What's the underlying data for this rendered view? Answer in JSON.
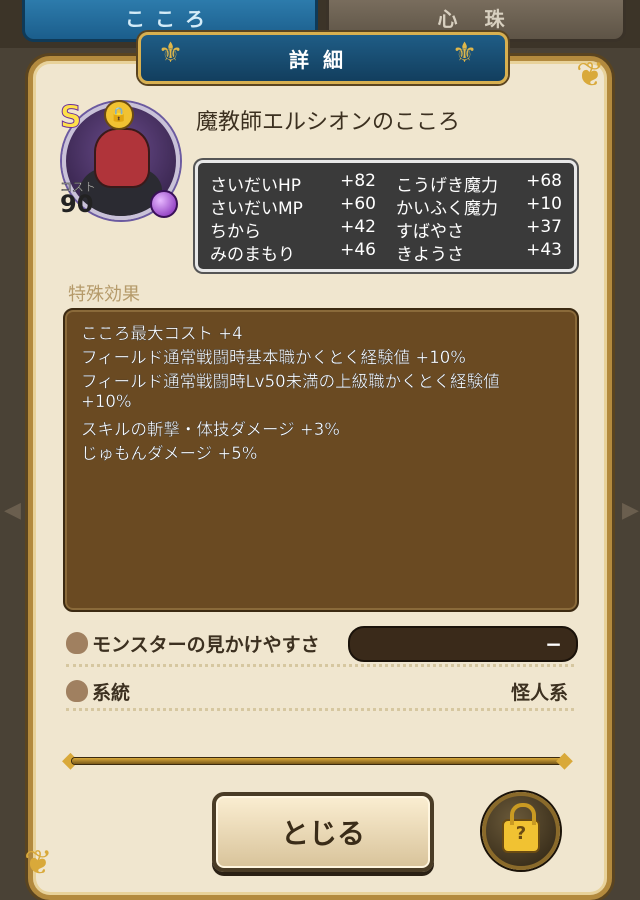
{
  "tabs": [
    {
      "label": "こころ",
      "active": true
    },
    {
      "label": "心 珠",
      "active": false
    }
  ],
  "header": {
    "title": "詳細"
  },
  "monster": {
    "rank": "S",
    "cost_label": "コスト",
    "cost": "90",
    "name": "魔教師エルシオンのこころ"
  },
  "stats": [
    {
      "label": "さいだいHP",
      "value": "+82"
    },
    {
      "label": "こうげき魔力",
      "value": "+68"
    },
    {
      "label": "さいだいMP",
      "value": "+60"
    },
    {
      "label": "かいふく魔力",
      "value": "+10"
    },
    {
      "label": "ちから",
      "value": "+42"
    },
    {
      "label": "すばやさ",
      "value": "+37"
    },
    {
      "label": "みのまもり",
      "value": "+46"
    },
    {
      "label": "きようさ",
      "value": "+43"
    }
  ],
  "special": {
    "label": "特殊効果",
    "lines": [
      "こころ最大コスト +4",
      "フィールド通常戦闘時基本職かくとく経験値 +10%",
      "フィールド通常戦闘時Lv50未満の上級職かくとく経験値",
      "+10%",
      "スキルの斬撃・体技ダメージ +3%",
      "じゅもんダメージ +5%"
    ]
  },
  "visibility": {
    "label": "モンスターの見かけやすさ",
    "value": "−"
  },
  "lineage": {
    "label": "系統",
    "value": "怪人系"
  },
  "buttons": {
    "close": "とじる"
  },
  "colors": {
    "accent": "#d9a93a",
    "tab_active": "#1b5e8c",
    "panel": "#f0e6cf"
  }
}
